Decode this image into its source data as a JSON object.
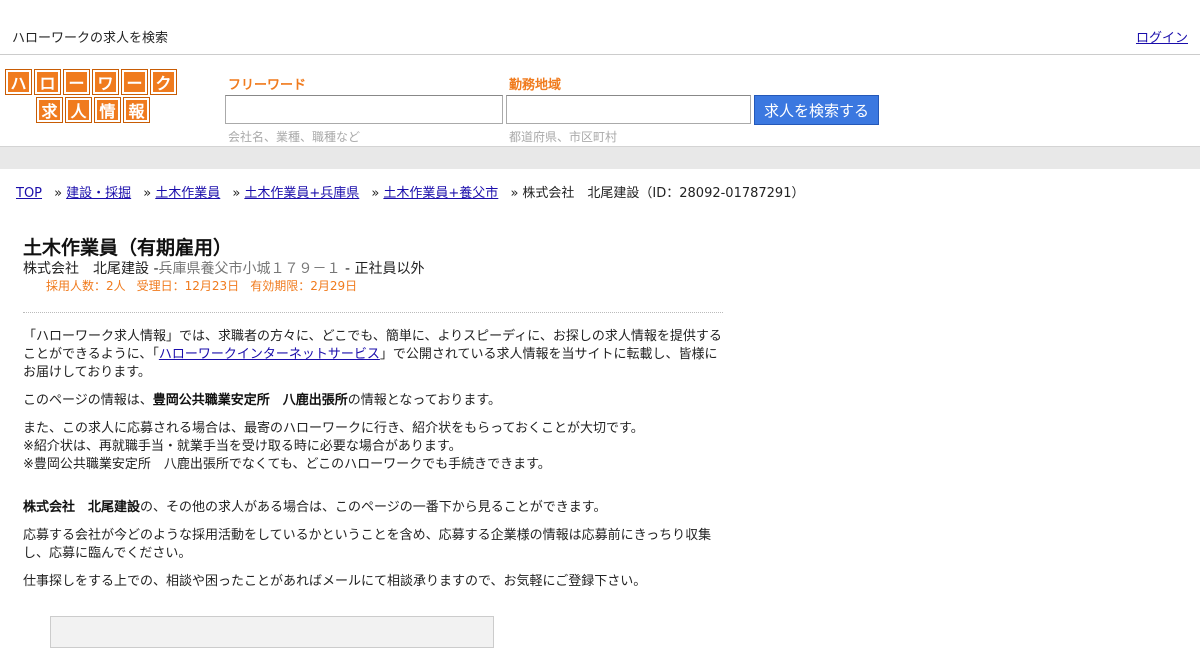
{
  "header": {
    "site_tag": "ハローワークの求人を検索",
    "login_label": "ログイン"
  },
  "logo": {
    "row1": [
      "ハ",
      "ロ",
      "ー",
      "ワ",
      "ー",
      "ク"
    ],
    "row2": [
      "求",
      "人",
      "情",
      "報"
    ]
  },
  "search": {
    "freeword_label": "フリーワード",
    "freeword_value": "",
    "freeword_hint": "会社名、業種、職種など",
    "area_label": "勤務地域",
    "area_value": "",
    "area_hint": "都道府県、市区町村",
    "button_label": "求人を検索する"
  },
  "breadcrumb": {
    "items": [
      "TOP",
      "建設・採掘",
      "土木作業員",
      "土木作業員+兵庫県",
      "土木作業員+養父市"
    ],
    "separator": "»",
    "current": "株式会社　北尾建設（ID：28092-01787291）"
  },
  "job": {
    "title": "土木作業員（有期雇用）",
    "company": "株式会社　北尾建設",
    "address": "兵庫県養父市小城１７９－１",
    "employment_type": "正社員以外",
    "hires": "採用人数：2人",
    "received": "受理日：12月23日",
    "expiry": "有効期限：2月29日"
  },
  "body": {
    "intro_before": "「ハローワーク求人情報」では、求職者の方々に、どこでも、簡単に、よりスピーディに、お探しの求人情報を提供することができるように、「",
    "intro_link": "ハローワークインターネットサービス",
    "intro_after": "」で公開されている求人情報を当サイトに転載し、皆様にお届けしております。",
    "source_before": "このページの情報は、",
    "source_office": "豊岡公共職業安定所　八鹿出張所",
    "source_after": "の情報となっております。",
    "notice_line1": "また、この求人に応募される場合は、最寄のハローワークに行き、紹介状をもらっておくことが大切です。",
    "notice_line2": "※紹介状は、再就職手当・就業手当を受け取る時に必要な場合があります。",
    "notice_line3": "※豊岡公共職業安定所　八鹿出張所でなくても、どこのハローワークでも手続きできます。",
    "other_company": "株式会社　北尾建設",
    "other_after": "の、その他の求人がある場合は、このページの一番下から見ることができます。",
    "research": "応募する会社が今どのような採用活動をしているかということを含め、応募する企業様の情報は応募前にきっちり収集し、応募に臨んでください。",
    "contact": "仕事探しをする上での、相談や困ったことがあればメールにて相談承りますので、お気軽にご登録下さい。"
  }
}
